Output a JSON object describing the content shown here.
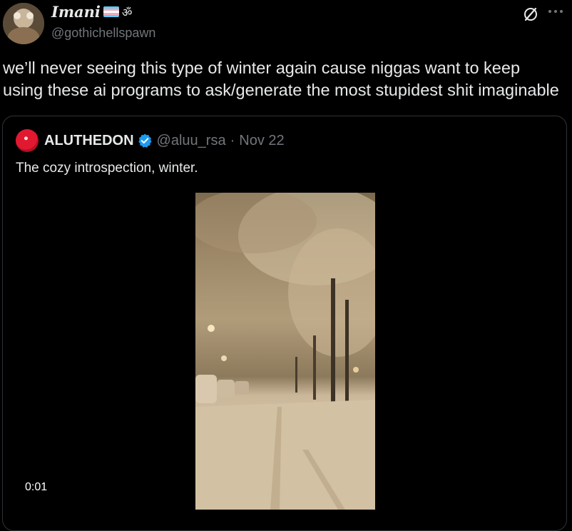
{
  "header": {
    "display_name": "Imani",
    "symbol": "ॐ",
    "handle": "@gothichellspawn",
    "grok_icon": "grok-slash-circle-icon",
    "more_icon": "more-horizontal-icon"
  },
  "tweet": {
    "text_line1": "we’ll never seeing this type of winter again cause niggas want to keep",
    "text_line2": "using these ai programs to ask/generate the most stupidest shit imaginable"
  },
  "quote": {
    "name": "ALUTHEDON",
    "verified_icon": "verified-badge-icon",
    "handle": "@aluu_rsa",
    "dot": "·",
    "date": "Nov 22",
    "text": "The cozy introspection, winter.",
    "video_time": "0:01"
  },
  "colors": {
    "background": "#000000",
    "text": "#e7e9ea",
    "muted": "#71767b",
    "border": "#2f3336",
    "verified": "#1d9bf0",
    "trans_blue": "#5bcefa",
    "trans_pink": "#f5a9b8",
    "trans_white": "#ffffff"
  }
}
